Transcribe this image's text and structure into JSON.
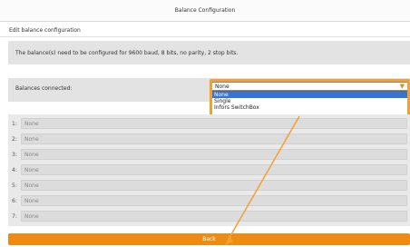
{
  "window": {
    "title": "Balance Configuration"
  },
  "subheader": {
    "text": "Edit balance configuration"
  },
  "info": {
    "text": "The balance(s) need to be configured for 9600 baud, 8 bits, no parity, 2 stop bits."
  },
  "balances": {
    "label": "Balances connected:",
    "selected_value": "None",
    "options": [
      "None",
      "Single",
      "Infors SwitchBox"
    ]
  },
  "balance_rows": [
    {
      "number": "1:",
      "value": "None"
    },
    {
      "number": "2:",
      "value": "None"
    },
    {
      "number": "3:",
      "value": "None"
    },
    {
      "number": "4:",
      "value": "None"
    },
    {
      "number": "5:",
      "value": "None"
    },
    {
      "number": "6:",
      "value": "None"
    },
    {
      "number": "7:",
      "value": "None"
    }
  ],
  "footer": {
    "back_label": "Back"
  },
  "colors": {
    "accent": "#ef8a12",
    "highlight": "#f3a032",
    "selection": "#3574d6"
  }
}
